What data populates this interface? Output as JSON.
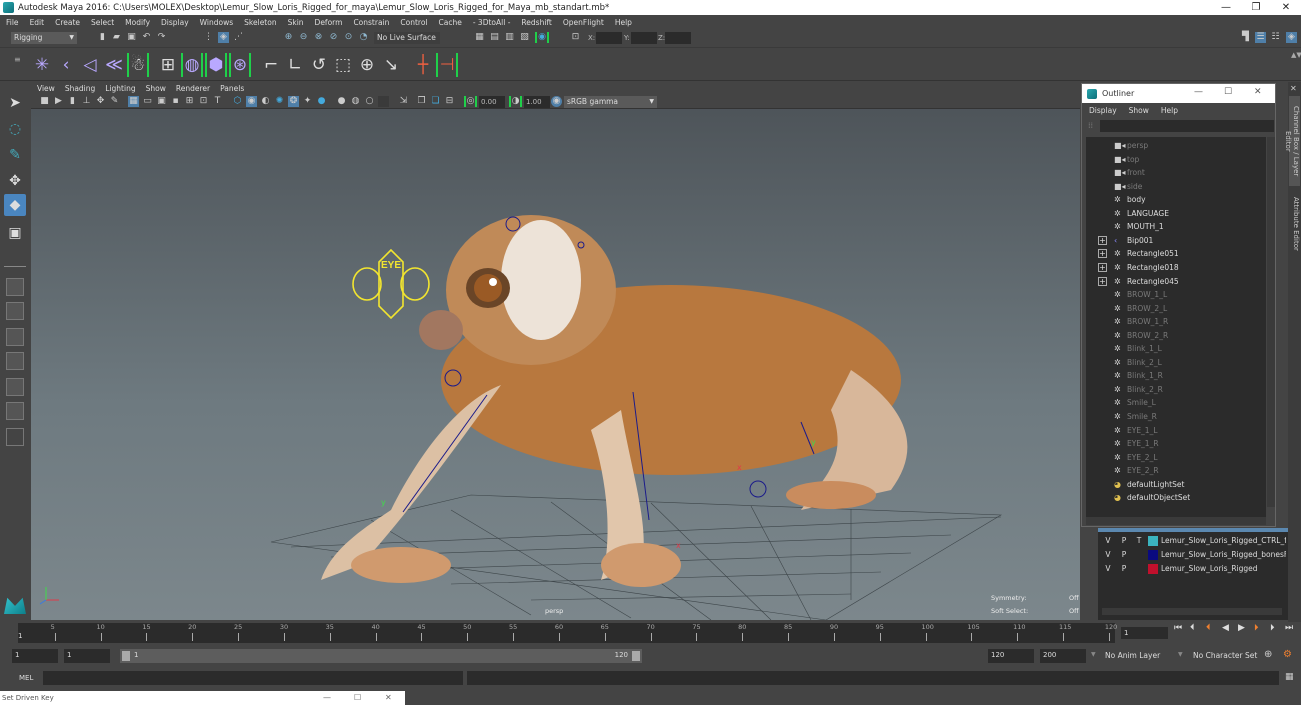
{
  "window": {
    "title": "Autodesk Maya 2016: C:\\Users\\MOLEX\\Desktop\\Lemur_Slow_Loris_Rigged_for_maya\\Lemur_Slow_Loris_Rigged_for_Maya_mb_standart.mb*",
    "controls": {
      "minimize": "—",
      "restore": "❐",
      "close": "✕"
    }
  },
  "menubar": [
    "File",
    "Edit",
    "Create",
    "Select",
    "Modify",
    "Display",
    "Windows",
    "Skeleton",
    "Skin",
    "Deform",
    "Constrain",
    "Control",
    "Cache",
    "- 3DtoAll -",
    "Redshift",
    "OpenFlight",
    "Help"
  ],
  "status_line": {
    "menu_set": "Rigging",
    "live_surface": "No Live Surface",
    "x_label": "X:",
    "y_label": "Y:",
    "z_label": "Z:"
  },
  "viewport": {
    "menu": [
      "View",
      "Shading",
      "Lighting",
      "Show",
      "Renderer",
      "Panels"
    ],
    "exposure": "0.00",
    "gamma": "1.00",
    "color_space": "sRGB gamma",
    "camera_label": "persp",
    "hud": [
      {
        "label": "Symmetry:",
        "value": "Off"
      },
      {
        "label": "Soft Select:",
        "value": "Off"
      }
    ],
    "eye_control_label": "EYE"
  },
  "outliner": {
    "title": "Outliner",
    "menu": [
      "Display",
      "Show",
      "Help"
    ],
    "search_value": "",
    "items": [
      {
        "label": "persp",
        "icon": "camera-icon",
        "active": false,
        "expandable": false
      },
      {
        "label": "top",
        "icon": "camera-icon",
        "active": false,
        "expandable": false
      },
      {
        "label": "front",
        "icon": "camera-icon",
        "active": false,
        "expandable": false
      },
      {
        "label": "side",
        "icon": "camera-icon",
        "active": false,
        "expandable": false
      },
      {
        "label": "body",
        "icon": "transform-icon",
        "active": true,
        "expandable": false
      },
      {
        "label": "LANGUAGE",
        "icon": "transform-icon",
        "active": true,
        "expandable": false
      },
      {
        "label": "MOUTH_1",
        "icon": "transform-icon",
        "active": true,
        "expandable": false
      },
      {
        "label": "Bip001",
        "icon": "joint-icon",
        "active": true,
        "expandable": true
      },
      {
        "label": "Rectangle051",
        "icon": "transform-icon",
        "active": true,
        "expandable": true
      },
      {
        "label": "Rectangle018",
        "icon": "transform-icon",
        "active": true,
        "expandable": true
      },
      {
        "label": "Rectangle045",
        "icon": "transform-icon",
        "active": true,
        "expandable": true
      },
      {
        "label": "BROW_1_L",
        "icon": "transform-icon",
        "active": false,
        "expandable": false
      },
      {
        "label": "BROW_2_L",
        "icon": "transform-icon",
        "active": false,
        "expandable": false
      },
      {
        "label": "BROW_1_R",
        "icon": "transform-icon",
        "active": false,
        "expandable": false
      },
      {
        "label": "BROW_2_R",
        "icon": "transform-icon",
        "active": false,
        "expandable": false
      },
      {
        "label": "Blink_1_L",
        "icon": "transform-icon",
        "active": false,
        "expandable": false
      },
      {
        "label": "Blink_2_L",
        "icon": "transform-icon",
        "active": false,
        "expandable": false
      },
      {
        "label": "Blink_1_R",
        "icon": "transform-icon",
        "active": false,
        "expandable": false
      },
      {
        "label": "Blink_2_R",
        "icon": "transform-icon",
        "active": false,
        "expandable": false
      },
      {
        "label": "Smile_L",
        "icon": "transform-icon",
        "active": false,
        "expandable": false
      },
      {
        "label": "Smile_R",
        "icon": "transform-icon",
        "active": false,
        "expandable": false
      },
      {
        "label": "EYE_1_L",
        "icon": "transform-icon",
        "active": false,
        "expandable": false
      },
      {
        "label": "EYE_1_R",
        "icon": "transform-icon",
        "active": false,
        "expandable": false
      },
      {
        "label": "EYE_2_L",
        "icon": "transform-icon",
        "active": false,
        "expandable": false
      },
      {
        "label": "EYE_2_R",
        "icon": "transform-icon",
        "active": false,
        "expandable": false
      },
      {
        "label": "defaultLightSet",
        "icon": "set-icon",
        "active": true,
        "expandable": false
      },
      {
        "label": "defaultObjectSet",
        "icon": "set-icon",
        "active": true,
        "expandable": false
      }
    ]
  },
  "layers": [
    {
      "v": "V",
      "p": "P",
      "t": "T",
      "color": "#3bb4bf",
      "name": "Lemur_Slow_Loris_Rigged_CTRL_fre"
    },
    {
      "v": "V",
      "p": "P",
      "t": "",
      "color": "#0a0a80",
      "name": "Lemur_Slow_Loris_Rigged_bonesFB"
    },
    {
      "v": "V",
      "p": "P",
      "t": "",
      "color": "#c0102c",
      "name": "Lemur_Slow_Loris_Rigged"
    }
  ],
  "side_tabs": [
    "Channel Box / Layer Editor",
    "Attribute Editor"
  ],
  "timeline": {
    "ticks": [
      "5",
      "10",
      "15",
      "20",
      "25",
      "30",
      "35",
      "40",
      "45",
      "50",
      "55",
      "60",
      "65",
      "70",
      "75",
      "80",
      "85",
      "90",
      "95",
      "100",
      "105",
      "110",
      "115",
      "120"
    ],
    "current_marker": "1",
    "current_frame": "1"
  },
  "range": {
    "start": "1",
    "playback_start": "1",
    "slider_start": "1",
    "slider_end": "120",
    "playback_end": "120",
    "end": "200",
    "anim_layer": "No Anim Layer",
    "character_set": "No Character Set"
  },
  "command_line": {
    "label": "MEL",
    "value": ""
  },
  "set_driven_key": {
    "title": "Set Driven Key"
  }
}
